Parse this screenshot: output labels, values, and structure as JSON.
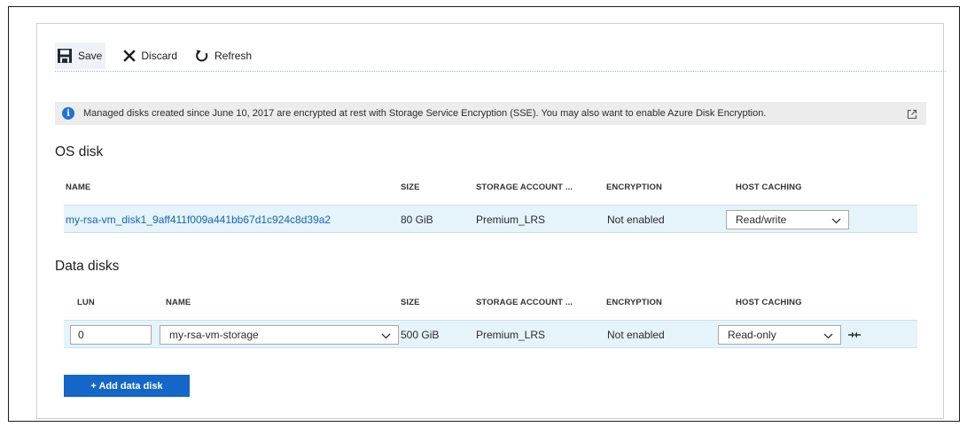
{
  "toolbar": {
    "save_label": "Save",
    "discard_label": "Discard",
    "refresh_label": "Refresh"
  },
  "info": {
    "text": "Managed disks created since June 10, 2017 are encrypted at rest with Storage Service Encryption (SSE). You may also want to enable Azure Disk Encryption."
  },
  "os_disk": {
    "title": "OS disk",
    "columns": [
      "NAME",
      "SIZE",
      "STORAGE ACCOUNT ...",
      "ENCRYPTION",
      "HOST CACHING"
    ],
    "row": {
      "name": "my-rsa-vm_disk1_9aff411f009a441bb67d1c924c8d39a2",
      "size": "80 GiB",
      "storage": "Premium_LRS",
      "encryption": "Not enabled",
      "host_caching": "Read/write"
    }
  },
  "data_disks": {
    "title": "Data disks",
    "columns": [
      "LUN",
      "NAME",
      "SIZE",
      "STORAGE ACCOUNT ...",
      "ENCRYPTION",
      "HOST CACHING"
    ],
    "row": {
      "lun": "0",
      "name": "my-rsa-vm-storage",
      "size": "500 GiB",
      "storage": "Premium_LRS",
      "encryption": "Not enabled",
      "host_caching": "Read-only"
    }
  },
  "add_button_label": "+ Add data disk",
  "colors": {
    "accent": "#1466c8",
    "link": "#1565b7",
    "row_highlight": "#e5f3fa",
    "info_bg": "#ececec"
  },
  "icons": [
    "save-icon",
    "discard-icon",
    "refresh-icon",
    "info-icon",
    "external-link-icon",
    "chevron-down-icon",
    "detach-icon"
  ]
}
